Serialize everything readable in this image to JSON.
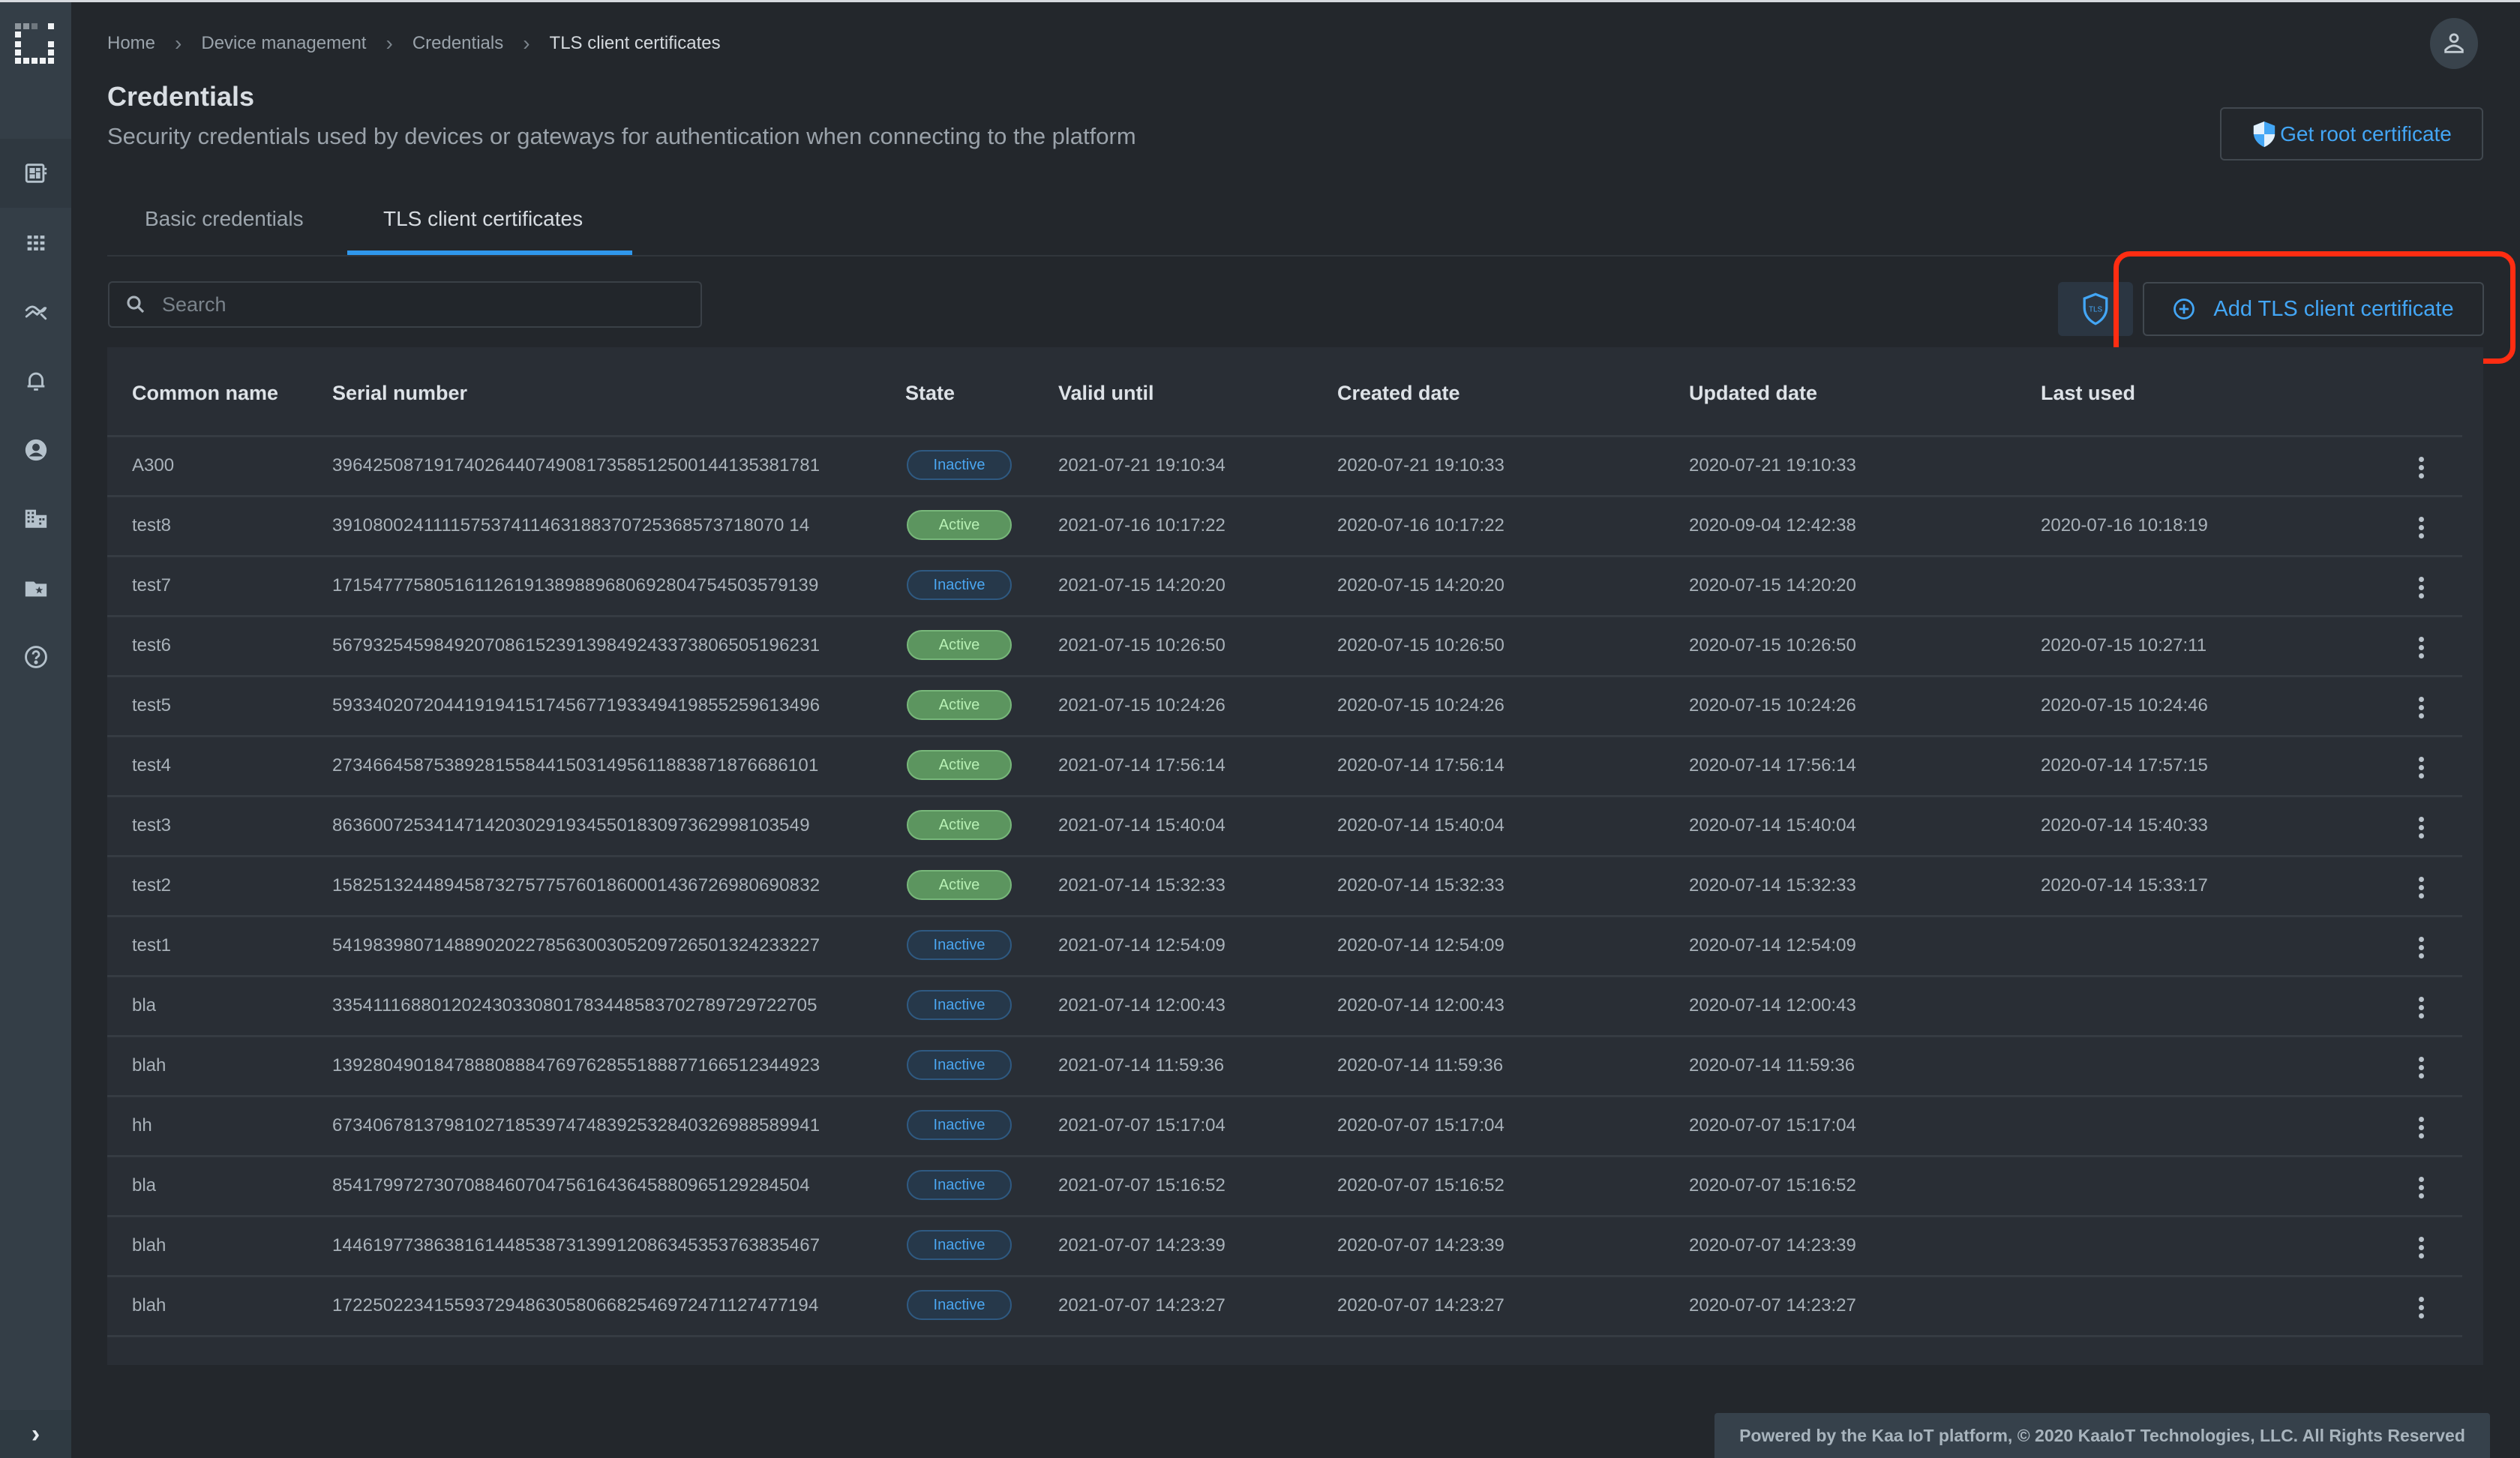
{
  "sidebar": {
    "logo": "kaa-logo",
    "items": [
      {
        "name": "dashboard",
        "icon": "dashboard-icon"
      },
      {
        "name": "applications",
        "icon": "grid-apps-icon"
      },
      {
        "name": "analytics",
        "icon": "trend-icon"
      },
      {
        "name": "alerts",
        "icon": "bell-icon"
      },
      {
        "name": "users",
        "icon": "account-circle-icon"
      },
      {
        "name": "tenants",
        "icon": "building-icon"
      },
      {
        "name": "solutions",
        "icon": "folder-star-icon"
      },
      {
        "name": "help",
        "icon": "help-circle-icon"
      }
    ],
    "expand_label": "›"
  },
  "breadcrumb": [
    "Home",
    "Device management",
    "Credentials",
    "TLS client certificates"
  ],
  "header": {
    "title": "Credentials",
    "subtitle": "Security credentials used by devices or gateways for authentication when connecting to the platform",
    "root_cert_button": "Get root certificate"
  },
  "tabs": [
    {
      "label": "Basic credentials",
      "active": false
    },
    {
      "label": "TLS client certificates",
      "active": true
    }
  ],
  "toolbar": {
    "search_placeholder": "Search",
    "search_value": "",
    "tls_button_label": "TLS",
    "add_button": "Add TLS client certificate"
  },
  "colors": {
    "accent": "#2f97ec",
    "active_badge": "#5c955f",
    "inactive_badge_text": "#4aa6f0",
    "highlight": "#ff2d12"
  },
  "table": {
    "columns": [
      "Common name",
      "Serial number",
      "State",
      "Valid until",
      "Created date",
      "Updated date",
      "Last used"
    ],
    "rows": [
      {
        "name": "A300",
        "serial": "396425087191740264407490817358512500144135381781",
        "state": "Inactive",
        "valid": "2021-07-21 19:10:34",
        "created": "2020-07-21 19:10:33",
        "updated": "2020-07-21 19:10:33",
        "last": ""
      },
      {
        "name": "test8",
        "serial": "391080024111157537411463188370725368573718070 14",
        "state": "Active",
        "valid": "2021-07-16 10:17:22",
        "created": "2020-07-16 10:17:22",
        "updated": "2020-09-04 12:42:38",
        "last": "2020-07-16 10:18:19"
      },
      {
        "name": "test7",
        "serial": "171547775805161126191389889680692804754503579139",
        "state": "Inactive",
        "valid": "2021-07-15 14:20:20",
        "created": "2020-07-15 14:20:20",
        "updated": "2020-07-15 14:20:20",
        "last": ""
      },
      {
        "name": "test6",
        "serial": "567932545984920708615239139849243373806505196231",
        "state": "Active",
        "valid": "2021-07-15 10:26:50",
        "created": "2020-07-15 10:26:50",
        "updated": "2020-07-15 10:26:50",
        "last": "2020-07-15 10:27:11"
      },
      {
        "name": "test5",
        "serial": "593340207204419194151745677193349419855259613496",
        "state": "Active",
        "valid": "2021-07-15 10:24:26",
        "created": "2020-07-15 10:24:26",
        "updated": "2020-07-15 10:24:26",
        "last": "2020-07-15 10:24:46"
      },
      {
        "name": "test4",
        "serial": "273466458753892815584415031495611883871876686101",
        "state": "Active",
        "valid": "2021-07-14 17:56:14",
        "created": "2020-07-14 17:56:14",
        "updated": "2020-07-14 17:56:14",
        "last": "2020-07-14 17:57:15"
      },
      {
        "name": "test3",
        "serial": "86360072534147142030291934550183097362998103549",
        "state": "Active",
        "valid": "2021-07-14 15:40:04",
        "created": "2020-07-14 15:40:04",
        "updated": "2020-07-14 15:40:04",
        "last": "2020-07-14 15:40:33"
      },
      {
        "name": "test2",
        "serial": "158251324489458732757757601860001436726980690832",
        "state": "Active",
        "valid": "2021-07-14 15:32:33",
        "created": "2020-07-14 15:32:33",
        "updated": "2020-07-14 15:32:33",
        "last": "2020-07-14 15:33:17"
      },
      {
        "name": "test1",
        "serial": "541983980714889020227856300305209726501324233227",
        "state": "Inactive",
        "valid": "2021-07-14 12:54:09",
        "created": "2020-07-14 12:54:09",
        "updated": "2020-07-14 12:54:09",
        "last": ""
      },
      {
        "name": "bla",
        "serial": "335411168801202430330801783448583702789729722705",
        "state": "Inactive",
        "valid": "2021-07-14 12:00:43",
        "created": "2020-07-14 12:00:43",
        "updated": "2020-07-14 12:00:43",
        "last": ""
      },
      {
        "name": "blah",
        "serial": "139280490184788808884769762855188877166512344923",
        "state": "Inactive",
        "valid": "2021-07-14 11:59:36",
        "created": "2020-07-14 11:59:36",
        "updated": "2020-07-14 11:59:36",
        "last": ""
      },
      {
        "name": "hh",
        "serial": "673406781379810271853974748392532840326988589941",
        "state": "Inactive",
        "valid": "2021-07-07 15:17:04",
        "created": "2020-07-07 15:17:04",
        "updated": "2020-07-07 15:17:04",
        "last": ""
      },
      {
        "name": "bla",
        "serial": "85417997273070884607047561643645880965129284504",
        "state": "Inactive",
        "valid": "2021-07-07 15:16:52",
        "created": "2020-07-07 15:16:52",
        "updated": "2020-07-07 15:16:52",
        "last": ""
      },
      {
        "name": "blah",
        "serial": "144619773863816144853873139912086345353763835467",
        "state": "Inactive",
        "valid": "2021-07-07 14:23:39",
        "created": "2020-07-07 14:23:39",
        "updated": "2020-07-07 14:23:39",
        "last": ""
      },
      {
        "name": "blah",
        "serial": "172250223415593729486305806682546972471127477194",
        "state": "Inactive",
        "valid": "2021-07-07 14:23:27",
        "created": "2020-07-07 14:23:27",
        "updated": "2020-07-07 14:23:27",
        "last": ""
      }
    ]
  },
  "footer": {
    "text": "Powered by the Kaa IoT platform, © 2020 KaaIoT Technologies, LLC. All Rights Reserved"
  }
}
